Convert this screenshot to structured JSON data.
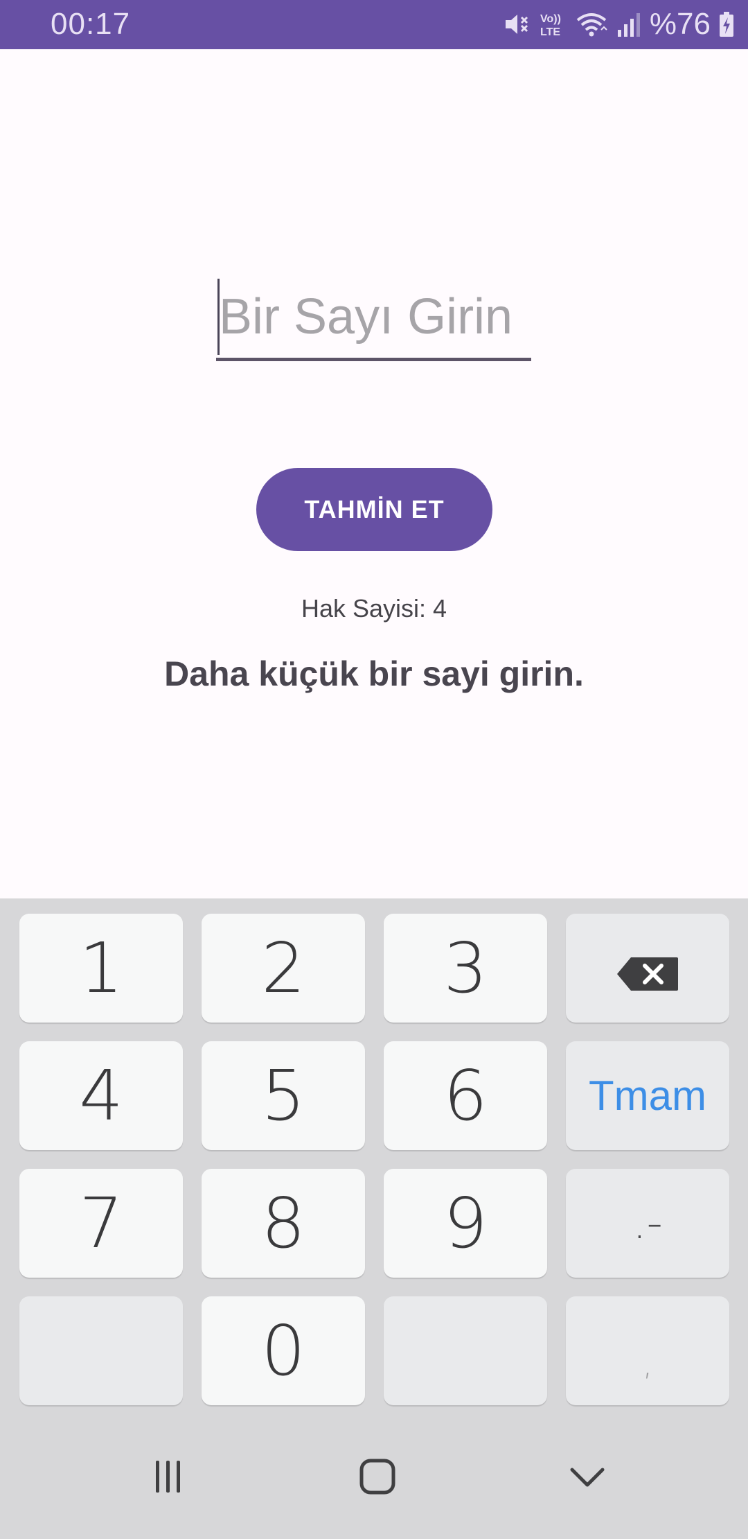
{
  "status_bar": {
    "time": "00:17",
    "battery": "%76",
    "icons": [
      "mute-icon",
      "volte-icon",
      "wifi-icon",
      "signal-icon",
      "battery-charging-icon"
    ]
  },
  "guess": {
    "placeholder": "Bir Sayı Girin",
    "value": "",
    "button_label": "TAHMİN ET",
    "attempts": "Hak Sayisi: 4",
    "hint": "Daha küçük bir sayi girin."
  },
  "keyboard": {
    "keys": {
      "k1": "1",
      "k2": "2",
      "k3": "3",
      "k4": "4",
      "k5": "5",
      "k6": "6",
      "k7": "7",
      "k8": "8",
      "k9": "9",
      "k0": "0"
    },
    "done_label": "Tmam",
    "dot_dash": ".-",
    "comma": ","
  },
  "colors": {
    "primary": "#6750a4",
    "background": "#fffbfe",
    "keyboard_bg": "#d7d7d9",
    "done_blue": "#3d8ee6"
  }
}
